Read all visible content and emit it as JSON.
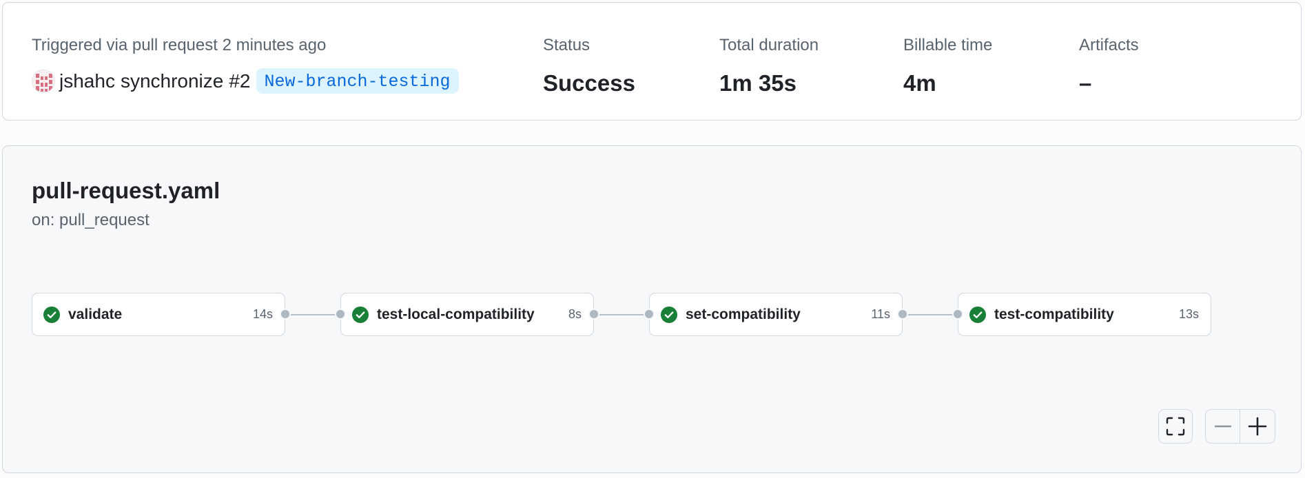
{
  "summary": {
    "trigger_label": "Triggered via pull request 2 minutes ago",
    "actor": "jshahc",
    "event": "synchronize",
    "pr_number": "#2",
    "branch": "New-branch-testing",
    "status": {
      "label": "Status",
      "value": "Success"
    },
    "total_duration": {
      "label": "Total duration",
      "value": "1m 35s"
    },
    "billable_time": {
      "label": "Billable time",
      "value": "4m"
    },
    "artifacts": {
      "label": "Artifacts",
      "value": "–"
    }
  },
  "workflow": {
    "name": "pull-request.yaml",
    "trigger": "on: pull_request",
    "jobs": [
      {
        "name": "validate",
        "duration": "14s",
        "status": "success"
      },
      {
        "name": "test-local-compatibility",
        "duration": "8s",
        "status": "success"
      },
      {
        "name": "set-compatibility",
        "duration": "11s",
        "status": "success"
      },
      {
        "name": "test-compatibility",
        "duration": "13s",
        "status": "success"
      }
    ]
  },
  "controls": {
    "fullscreen_icon": "fullscreen-icon",
    "zoom_out_icon": "minus-icon",
    "zoom_in_icon": "plus-icon"
  },
  "colors": {
    "success": "#1a7f37",
    "branch_text": "#0969da",
    "branch_bg": "#ddf4ff",
    "border": "#d1d9e0",
    "muted_text": "#59636e"
  }
}
